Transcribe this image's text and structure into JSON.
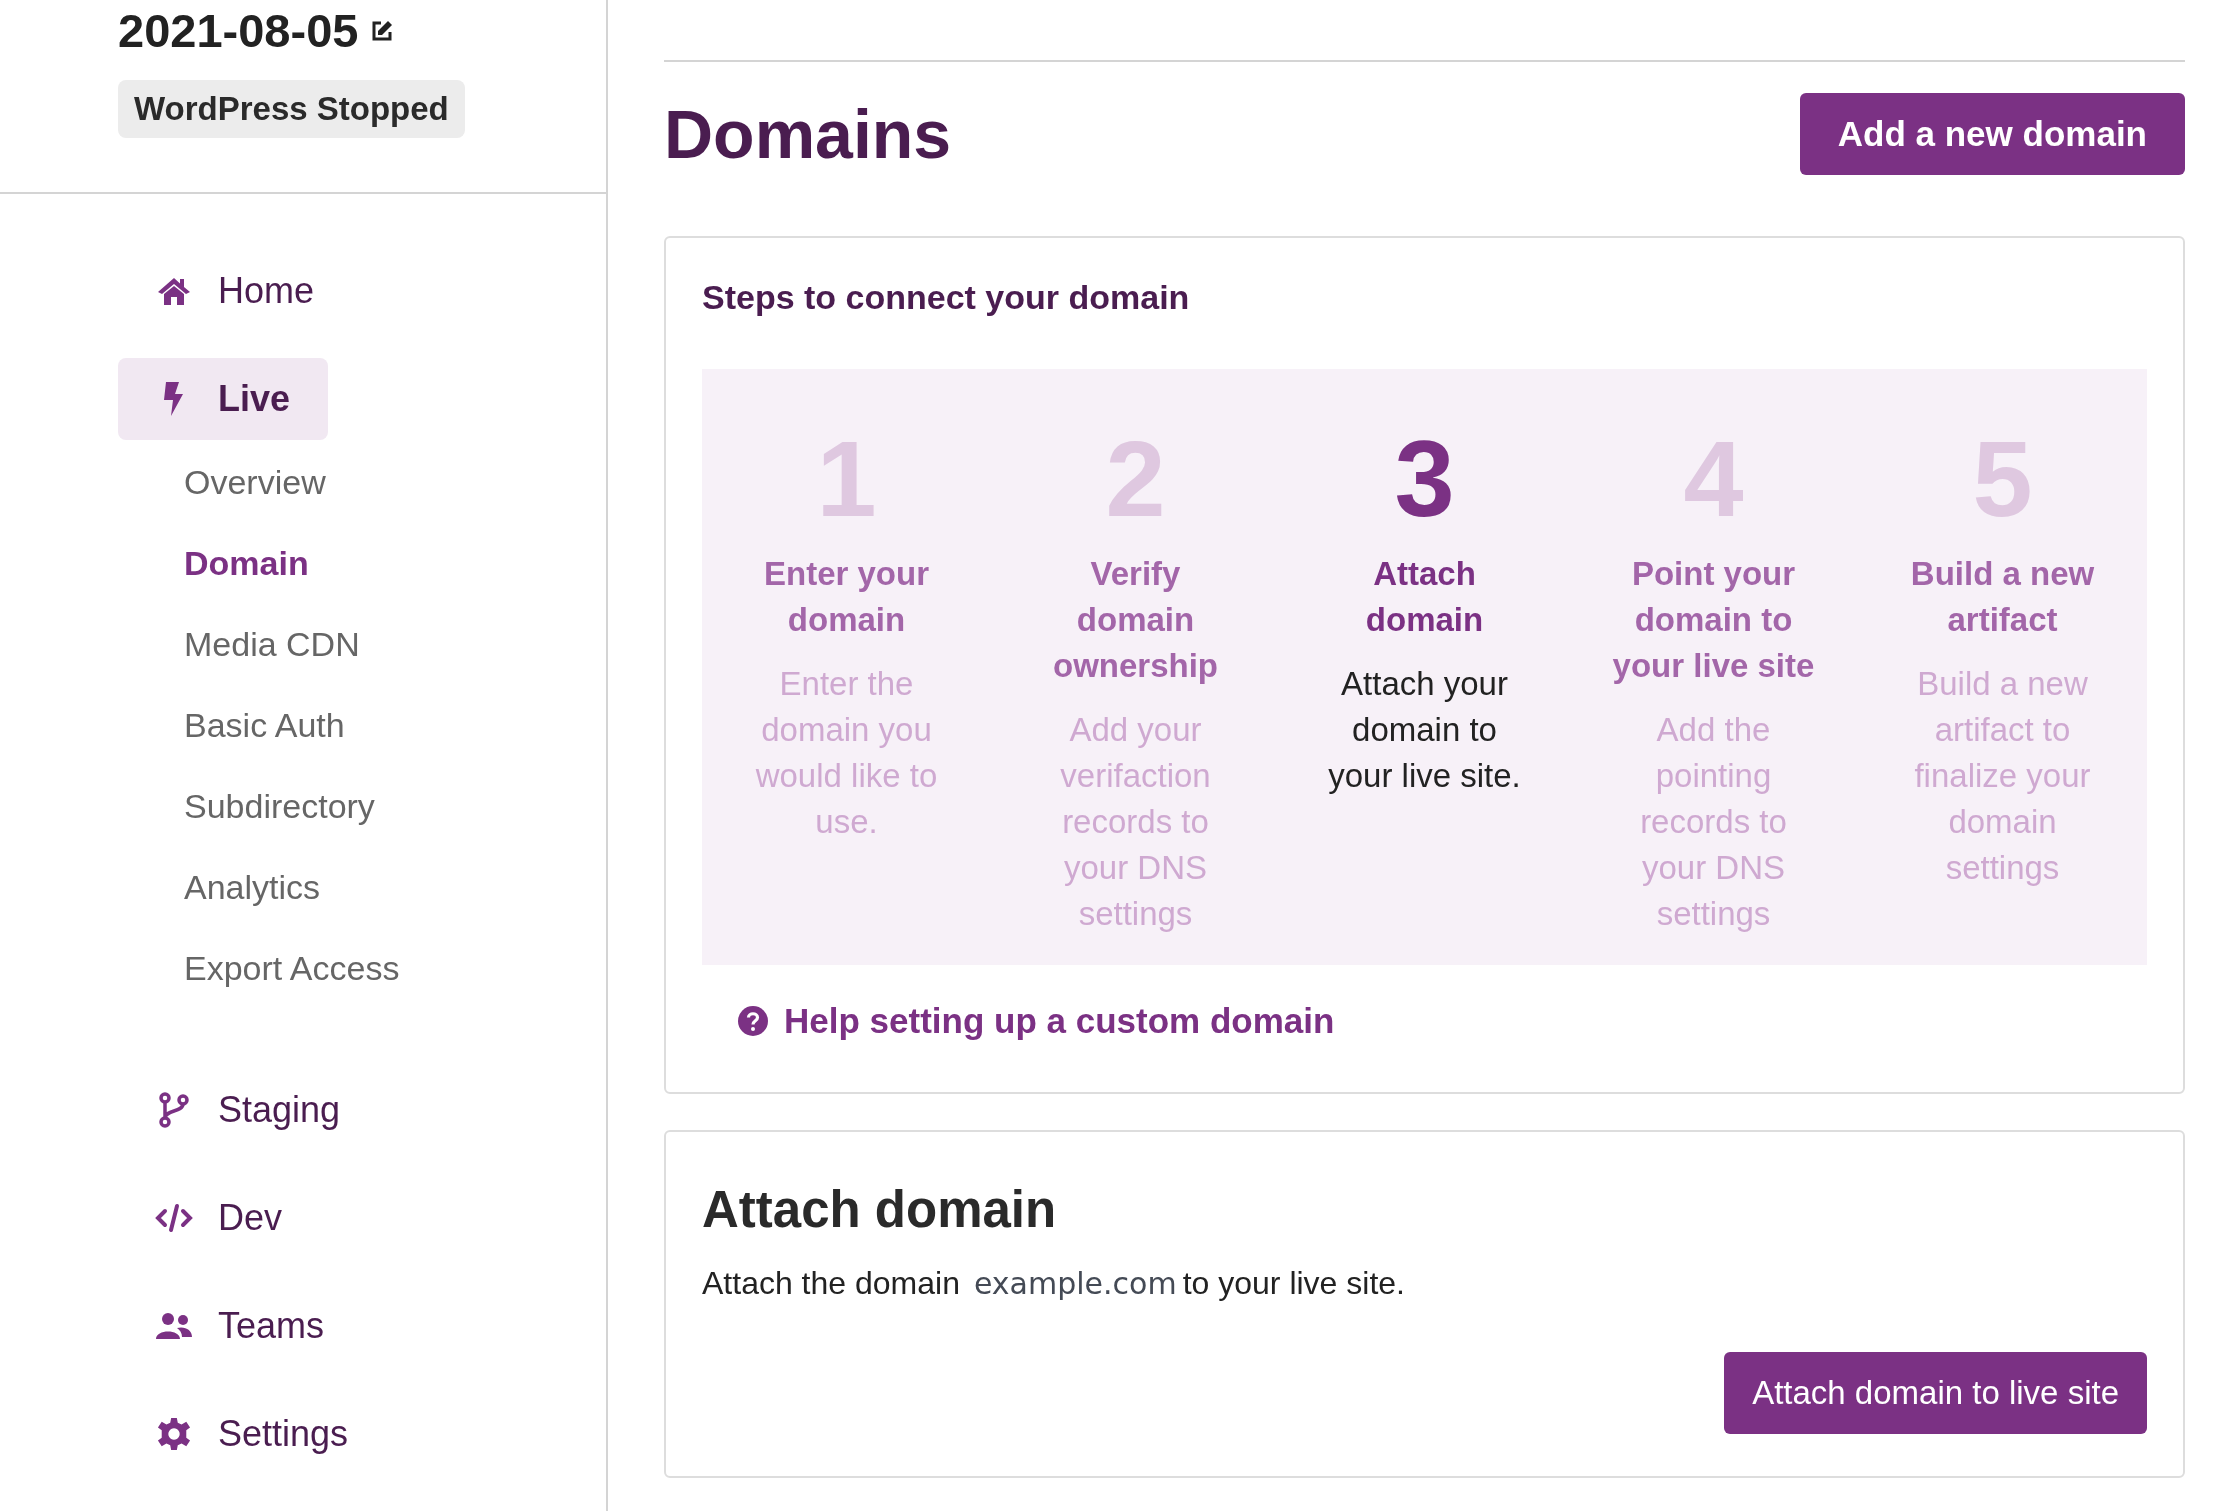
{
  "site": {
    "title": "2021-08-05",
    "status_badge": "WordPress Stopped"
  },
  "sidebar": {
    "items": [
      {
        "label": "Home",
        "selected": false
      },
      {
        "label": "Live",
        "selected": true,
        "children": [
          {
            "label": "Overview",
            "selected": false
          },
          {
            "label": "Domain",
            "selected": true
          },
          {
            "label": "Media CDN",
            "selected": false
          },
          {
            "label": "Basic Auth",
            "selected": false
          },
          {
            "label": "Subdirectory",
            "selected": false
          },
          {
            "label": "Analytics",
            "selected": false
          },
          {
            "label": "Export Access",
            "selected": false
          }
        ]
      },
      {
        "label": "Staging",
        "selected": false
      },
      {
        "label": "Dev",
        "selected": false
      },
      {
        "label": "Teams",
        "selected": false
      },
      {
        "label": "Settings",
        "selected": false
      }
    ]
  },
  "page": {
    "title": "Domains",
    "add_button": "Add a new domain"
  },
  "steps_card": {
    "title": "Steps to connect your domain",
    "steps": [
      {
        "number": "1",
        "title": "Enter your domain",
        "description": "Enter the domain you would like to use.",
        "selected": false
      },
      {
        "number": "2",
        "title": "Verify domain ownership",
        "description": "Add your verifaction records to your DNS settings",
        "selected": false
      },
      {
        "number": "3",
        "title": "Attach domain",
        "description": "Attach your domain to your live site.",
        "selected": true
      },
      {
        "number": "4",
        "title": "Point your domain to your live site",
        "description": "Add the pointing records to your DNS settings",
        "selected": false
      },
      {
        "number": "5",
        "title": "Build a new artifact",
        "description": "Build a new artifact to finalize your domain settings",
        "selected": false
      }
    ],
    "help_link": "Help setting up a custom domain"
  },
  "attach_card": {
    "title": "Attach domain",
    "text_before": "Attach the domain",
    "domain": "example.com",
    "text_after": "to your live site.",
    "button": "Attach domain to live site"
  }
}
